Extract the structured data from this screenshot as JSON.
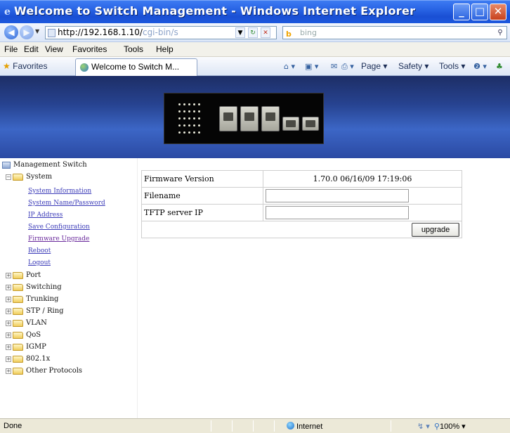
{
  "window": {
    "title": "Welcome to Switch Management - Windows Internet Explorer"
  },
  "address": {
    "url_visible": "http://192.168.1.10/",
    "url_faded": "cgi-bin/s",
    "search_placeholder": "bing"
  },
  "menu": [
    "File",
    "Edit",
    "View",
    "Favorites",
    "Tools",
    "Help"
  ],
  "commandbar": {
    "favorites": "Favorites",
    "tab_title": "Welcome to Switch M...",
    "page": "Page ▾",
    "safety": "Safety ▾",
    "tools": "Tools ▾"
  },
  "sidebar": {
    "root": "Management Switch",
    "system": "System",
    "system_links": [
      "System Information",
      "System Name/Password",
      "IP Address",
      "Save Configuration",
      "Firmware Upgrade",
      "Reboot",
      "Logout"
    ],
    "folders": [
      "Port",
      "Switching",
      "Trunking",
      "STP / Ring",
      "VLAN",
      "QoS",
      "IGMP",
      "802.1x",
      "Other Protocols"
    ]
  },
  "firmware": {
    "version_label": "Firmware Version",
    "version_value": "1.70.0 06/16/09 17:19:06",
    "filename_label": "Filename",
    "filename_value": "",
    "tftp_label": "TFTP server IP",
    "tftp_value": "",
    "upgrade_label": "upgrade"
  },
  "status": {
    "text": "Done",
    "zone": "Internet",
    "zoom": "100%"
  },
  "colors": {
    "titlebar": "#2863e4",
    "banner": "#274391",
    "link": "#3a3ab8"
  }
}
